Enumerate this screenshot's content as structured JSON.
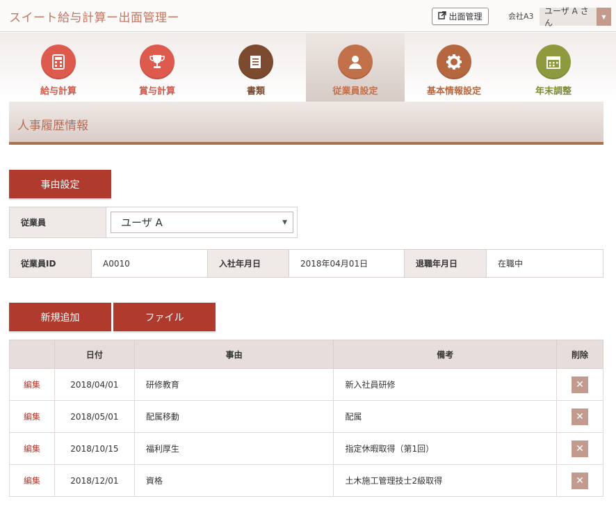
{
  "header": {
    "app_title": "スイート給与計算ー出面管理ー",
    "dememen_button": "出面管理",
    "company": "会社A3",
    "user": "ユーザ A さん"
  },
  "nav": {
    "items": [
      {
        "label": "給与計算",
        "icon": "calculator-icon",
        "color": "#dd5a4d"
      },
      {
        "label": "賞与計算",
        "icon": "trophy-icon",
        "color": "#dd5a4d"
      },
      {
        "label": "書類",
        "icon": "document-icon",
        "color": "#7b4a2f"
      },
      {
        "label": "従業員設定",
        "icon": "person-icon",
        "color": "#c2704a"
      },
      {
        "label": "基本情報設定",
        "icon": "gear-icon",
        "color": "#b5673f"
      },
      {
        "label": "年末調整",
        "icon": "calendar-icon",
        "color": "#8f9a3e"
      }
    ],
    "active_index": 3
  },
  "section": {
    "title": "人事履歴情報"
  },
  "actions": {
    "reason_settings": "事由設定",
    "add_new": "新規追加",
    "file": "ファイル"
  },
  "employee": {
    "label": "従業員",
    "selected": "ユーザ A"
  },
  "info": {
    "id_label": "従業員ID",
    "id_value": "A0010",
    "join_label": "入社年月日",
    "join_value": "2018年04月01日",
    "retire_label": "退職年月日",
    "retire_value": "在職中"
  },
  "table": {
    "headers": [
      "",
      "日付",
      "事由",
      "備考",
      "削除"
    ],
    "edit_label": "編集",
    "rows": [
      {
        "date": "2018/04/01",
        "reason": "研修教育",
        "note": "新入社員研修"
      },
      {
        "date": "2018/05/01",
        "reason": "配属移動",
        "note": "配属"
      },
      {
        "date": "2018/10/15",
        "reason": "福利厚生",
        "note": "指定休暇取得（第1回）"
      },
      {
        "date": "2018/12/01",
        "reason": "資格",
        "note": "土木施工管理技士2級取得"
      }
    ]
  },
  "colors": {
    "accent": "#b03a2e",
    "title": "#c47664",
    "section_border": "#a8704e"
  }
}
